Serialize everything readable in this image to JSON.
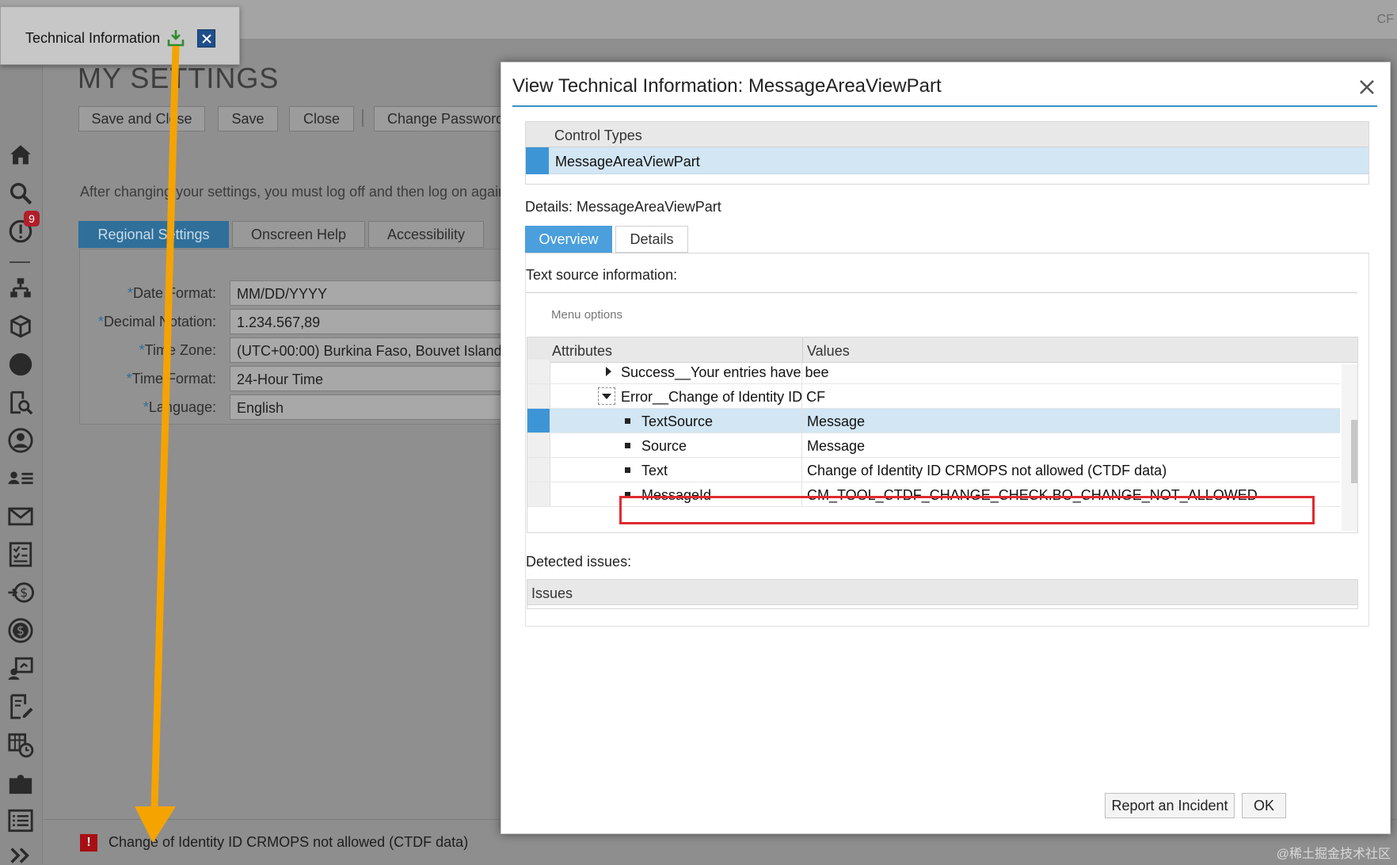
{
  "app": {
    "corner_text": "CF",
    "page_title": "MY SETTINGS"
  },
  "toolbar": {
    "save_and_close": "Save and Close",
    "save": "Save",
    "close": "Close",
    "change_password": "Change Password"
  },
  "info_text": "After changing your settings, you must log off and then log on again",
  "notification_count": "9",
  "settings_tabs": [
    "Regional Settings",
    "Onscreen Help",
    "Accessibility"
  ],
  "form": [
    {
      "label": "Date Format:",
      "value": "MM/DD/YYYY"
    },
    {
      "label": "Decimal Notation:",
      "value": "1.234.567,89"
    },
    {
      "label": "Time Zone:",
      "value": "(UTC+00:00) Burkina Faso, Bouvet Island"
    },
    {
      "label": "Time Format:",
      "value": "24-Hour Time"
    },
    {
      "label": "Language:",
      "value": "English"
    }
  ],
  "status_message": "Change of Identity ID CRMOPS not allowed (CTDF data)",
  "tech_popup": {
    "title": "Technical Information"
  },
  "dialog": {
    "title": "View Technical Information: MessageAreaViewPart",
    "control_types_header": "Control Types",
    "control_type_selected": "MessageAreaViewPart",
    "details_label": "Details: MessageAreaViewPart",
    "tabs": [
      "Overview",
      "Details"
    ],
    "text_source_label": "Text source information:",
    "menu_options": "Menu options",
    "attr_header": "Attributes",
    "values_header": "Values",
    "rows": [
      {
        "attr": "Success__Your entries have bee",
        "value": ""
      },
      {
        "attr": "Error__Change of Identity ID CF",
        "value": ""
      },
      {
        "attr": "TextSource",
        "value": "Message"
      },
      {
        "attr": "Source",
        "value": "Message"
      },
      {
        "attr": "Text",
        "value": "Change of Identity ID CRMOPS not allowed (CTDF data)"
      },
      {
        "attr": "MessageId",
        "value": "CM_TOOL_CTDF_CHANGE_CHECK.BO_CHANGE_NOT_ALLOWED"
      }
    ],
    "detected_label": "Detected issues:",
    "issues_header": "Issues",
    "report_button": "Report an Incident",
    "ok_button": "OK"
  },
  "colors": {
    "accent": "#3d95d6",
    "highlight": "#e02a30",
    "arrow": "#f5a300",
    "error": "#a80f14"
  },
  "watermark": "@稀土掘金技术社区"
}
